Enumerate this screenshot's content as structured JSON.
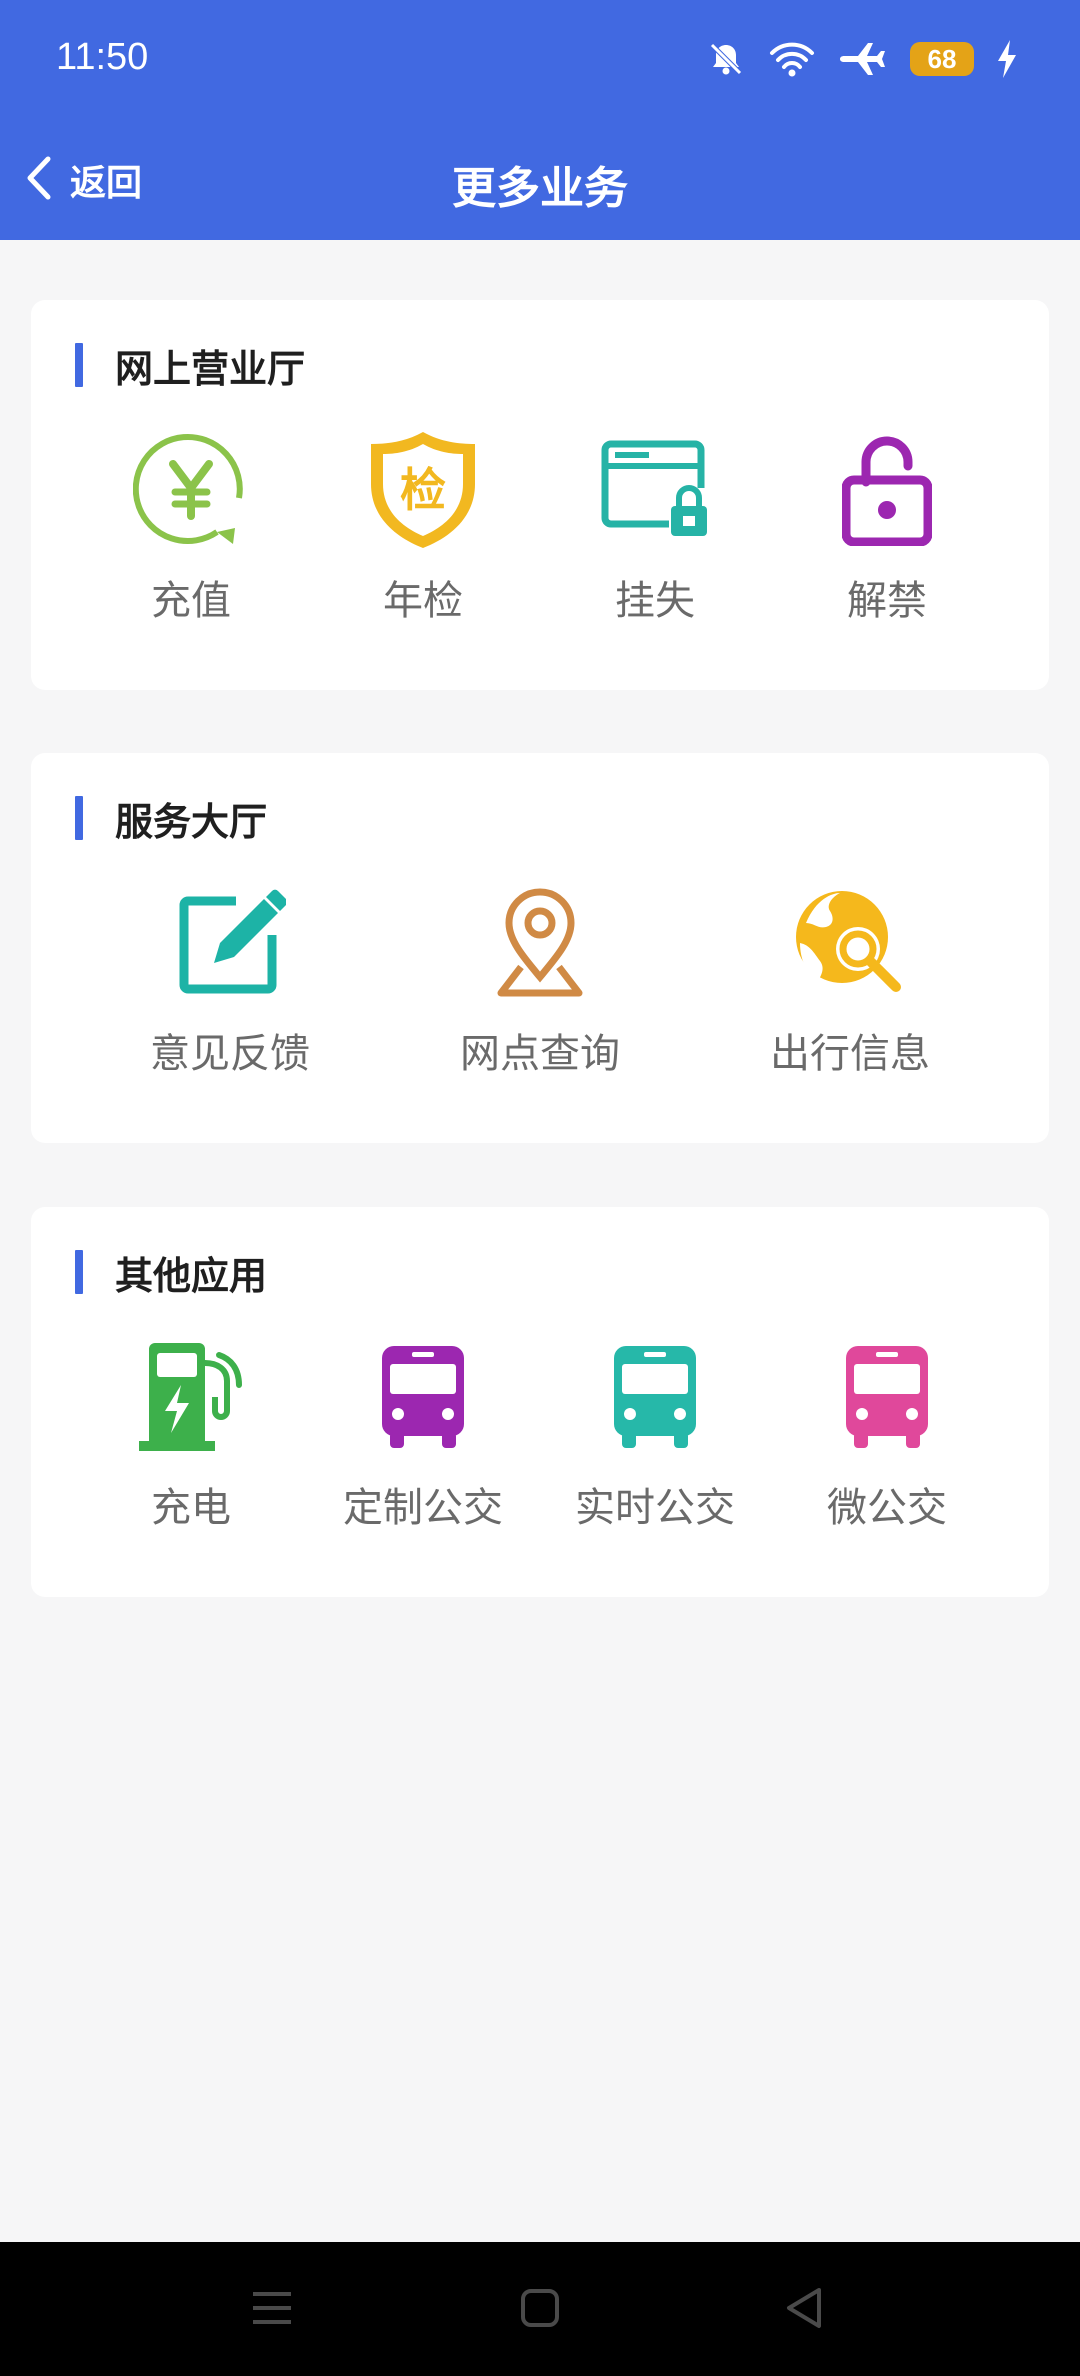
{
  "status": {
    "time": "11:50",
    "battery": "68"
  },
  "header": {
    "back_label": "返回",
    "title": "更多业务"
  },
  "sections": [
    {
      "title": "网上营业厅",
      "items": [
        {
          "label": "充值",
          "icon": "recharge-yen-icon",
          "color": "#8bc34a"
        },
        {
          "label": "年检",
          "icon": "annual-inspection-shield-icon",
          "icon_text": "检",
          "color": "#f2b820"
        },
        {
          "label": "挂失",
          "icon": "report-loss-card-lock-icon",
          "color": "#26b3a6"
        },
        {
          "label": "解禁",
          "icon": "unlock-padlock-icon",
          "color": "#9c27b0"
        }
      ]
    },
    {
      "title": "服务大厅",
      "items": [
        {
          "label": "意见反馈",
          "icon": "feedback-edit-icon",
          "color": "#1db3a6"
        },
        {
          "label": "网点查询",
          "icon": "location-pin-icon",
          "color": "#d08a45"
        },
        {
          "label": "出行信息",
          "icon": "travel-info-globe-search-icon",
          "color": "#f5b81c"
        }
      ]
    },
    {
      "title": "其他应用",
      "items": [
        {
          "label": "充电",
          "icon": "charging-station-icon",
          "color": "#3db04b"
        },
        {
          "label": "定制公交",
          "icon": "custom-bus-icon",
          "color": "#9c27b0"
        },
        {
          "label": "实时公交",
          "icon": "realtime-bus-icon",
          "color": "#26b8a9"
        },
        {
          "label": "微公交",
          "icon": "micro-bus-icon",
          "color": "#e0489b"
        }
      ]
    }
  ],
  "colors": {
    "primary": "#4169e1",
    "background": "#f6f6f7",
    "battery": "#e4a317"
  }
}
